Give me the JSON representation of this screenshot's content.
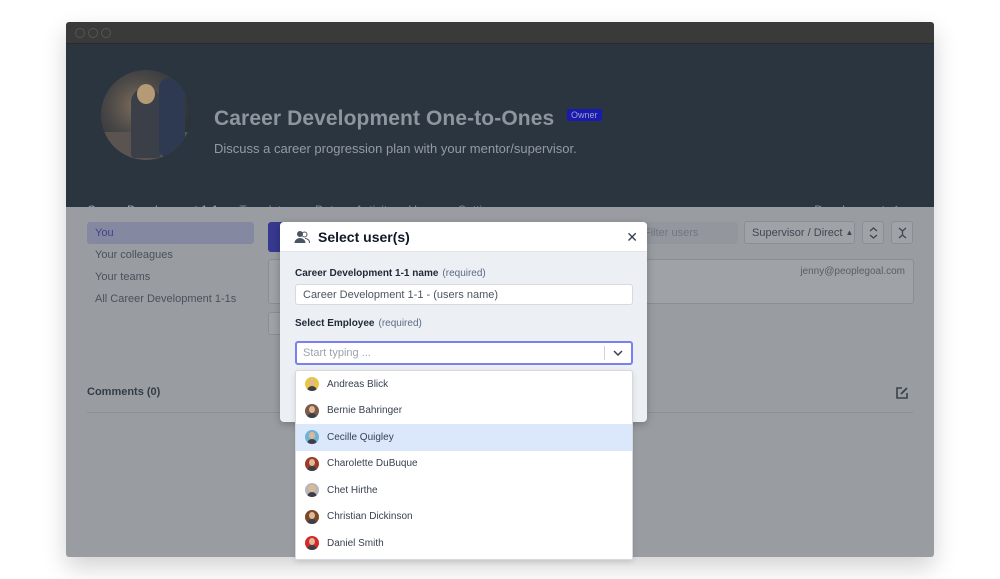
{
  "window": {
    "traffic_lights": [
      "close",
      "minimize",
      "maximize"
    ]
  },
  "header": {
    "title": "Career Development One-to-Ones",
    "badge": "Owner",
    "subtitle": "Discuss a career progression plan with your mentor/supervisor.",
    "hero_image": "team-meeting-photo",
    "tabs": [
      {
        "label": "Career Development 1-1s",
        "active": true
      },
      {
        "label": "Template",
        "has_dropdown": true
      },
      {
        "label": "Data"
      },
      {
        "label": "Activity"
      },
      {
        "label": "Usage"
      },
      {
        "label": "Settings"
      }
    ],
    "back_link": {
      "label": "Development",
      "icon": "undo-icon"
    }
  },
  "sidebar": {
    "items": [
      {
        "label": "You",
        "active": true
      },
      {
        "label": "Your colleagues"
      },
      {
        "label": "Your teams"
      },
      {
        "label": "All Career Development 1-1s"
      }
    ]
  },
  "toolbar": {
    "filter_placeholder": "Filter users",
    "role_select": "Supervisor / Direct",
    "expand_icon": "expand-icon",
    "collapse_icon": "collapse-icon"
  },
  "user_card": {
    "email": "jenny@peoplegoal.com"
  },
  "comments": {
    "title": "Comments (0)",
    "edit_icon": "edit-icon"
  },
  "modal": {
    "title": "Select user(s)",
    "icon": "users-icon",
    "close_icon": "close-icon",
    "name_field": {
      "label": "Career Development 1-1 name",
      "required": "(required)",
      "value": "Career Development 1-1 - (users name)"
    },
    "employee_field": {
      "label": "Select Employee",
      "required": "(required)",
      "placeholder": "Start typing ...",
      "options": [
        {
          "name": "Andreas Blick",
          "avatar_color": "#e8c640"
        },
        {
          "name": "Bernie Bahringer",
          "avatar_color": "#7a5a4a"
        },
        {
          "name": "Cecille Quigley",
          "avatar_color": "#6fb3d9",
          "highlighted": true
        },
        {
          "name": "Charolette DuBuque",
          "avatar_color": "#9c3b2a"
        },
        {
          "name": "Chet Hirthe",
          "avatar_color": "#b8b8b8"
        },
        {
          "name": "Christian Dickinson",
          "avatar_color": "#7a4a28"
        },
        {
          "name": "Daniel Smith",
          "avatar_color": "#d42a2a"
        }
      ]
    }
  },
  "colors": {
    "header_bg": "#2a3540",
    "accent": "#2525d0",
    "active_tab_underline": "#8a2747",
    "focus_border": "#7b7ff0",
    "highlight_row": "#dbe8fb"
  }
}
